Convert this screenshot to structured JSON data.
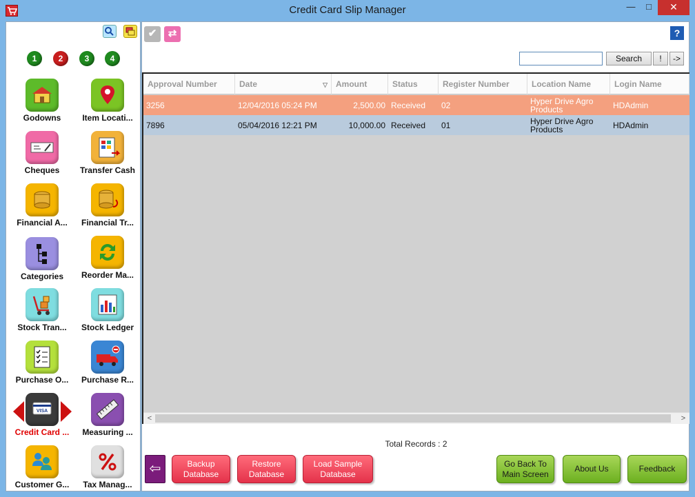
{
  "window": {
    "title": "Credit Card Slip Manager",
    "minimize": "—",
    "maximize": "□",
    "close": "✕"
  },
  "sidebar": {
    "pages": [
      "1",
      "2",
      "3",
      "4"
    ],
    "items": [
      {
        "label": "Godowns",
        "icon": "warehouse-icon",
        "color": "#5dbb2a"
      },
      {
        "label": "Item Locati...",
        "icon": "map-pin-icon",
        "color": "#7bc424"
      },
      {
        "label": "Cheques",
        "icon": "cheque-icon",
        "color": "#f06aa6"
      },
      {
        "label": "Transfer Cash",
        "icon": "cash-register-icon",
        "color": "#f2b23a"
      },
      {
        "label": "Financial A...",
        "icon": "coins-icon",
        "color": "#f5b500"
      },
      {
        "label": "Financial Tr...",
        "icon": "coins-transfer-icon",
        "color": "#f5b500"
      },
      {
        "label": "Categories",
        "icon": "tree-icon",
        "color": "#9a8fe0"
      },
      {
        "label": "Reorder Ma...",
        "icon": "recycle-icon",
        "color": "#f5b500"
      },
      {
        "label": "Stock Tran...",
        "icon": "trolley-icon",
        "color": "#7fdde0"
      },
      {
        "label": "Stock Ledger",
        "icon": "bar-chart-icon",
        "color": "#7fdde0"
      },
      {
        "label": "Purchase O...",
        "icon": "checklist-icon",
        "color": "#b4e03c"
      },
      {
        "label": "Purchase R...",
        "icon": "truck-icon",
        "color": "#3a86d4"
      },
      {
        "label": "Credit Card ...",
        "icon": "credit-card-icon",
        "color": "#3a3a3a"
      },
      {
        "label": "Measuring ...",
        "icon": "ruler-icon",
        "color": "#8a4fb0"
      },
      {
        "label": "Customer G...",
        "icon": "users-icon",
        "color": "#f5b500"
      },
      {
        "label": "Tax Manag...",
        "icon": "percent-icon",
        "color": "#e0e0e0"
      }
    ]
  },
  "toolbar": {
    "search_placeholder": "",
    "search_label": "Search",
    "bang_label": "!",
    "arrow_label": "->",
    "help_label": "?"
  },
  "grid": {
    "columns": [
      "Approval Number",
      "Date",
      "Amount",
      "Status",
      "Register Number",
      "Location Name",
      "Login Name"
    ],
    "rows": [
      {
        "approval": "3256",
        "date": "12/04/2016 05:24 PM",
        "amount": "2,500.00",
        "status": "Received",
        "register": "02",
        "location": "Hyper Drive Agro Products",
        "login": "HDAdmin"
      },
      {
        "approval": "7896",
        "date": "05/04/2016 12:21 PM",
        "amount": "10,000.00",
        "status": "Received",
        "register": "01",
        "location": "Hyper Drive Agro Products",
        "login": "HDAdmin"
      }
    ],
    "total": "Total Records : 2"
  },
  "actions": {
    "backup": "Backup Database",
    "restore": "Restore Database",
    "load_sample": "Load Sample Database",
    "go_back": "Go Back To Main Screen",
    "about": "About Us",
    "feedback": "Feedback"
  },
  "colors": {
    "selected_row": "#f4a07f",
    "alt_row": "#b9cbdd",
    "accent_red": "#e4324a",
    "accent_green": "#6cb020",
    "title_bar": "#7cb5e6"
  }
}
